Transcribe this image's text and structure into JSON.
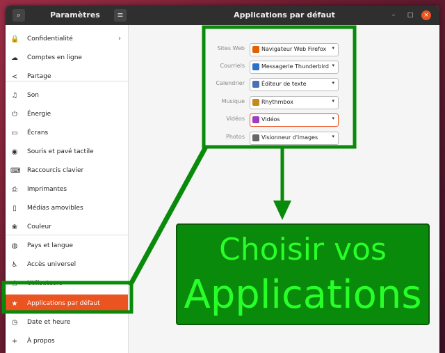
{
  "window": {
    "sidebar_title": "Paramètres",
    "title": "Applications par défaut",
    "search_icon": "search-icon",
    "menu_icon": "hamburger-menu-icon",
    "minimize": "–",
    "maximize": "□",
    "close": "×"
  },
  "sidebar": {
    "items": [
      {
        "icon": "lock-icon",
        "glyph": "🔒",
        "label": "Confidentialité",
        "chevron": "›"
      },
      {
        "icon": "cloud-icon",
        "glyph": "☁",
        "label": "Comptes en ligne"
      },
      {
        "icon": "share-icon",
        "glyph": "<",
        "label": "Partage"
      },
      {
        "icon": "music-icon",
        "glyph": "♫",
        "label": "Son"
      },
      {
        "icon": "power-icon",
        "glyph": "⏻",
        "label": "Énergie"
      },
      {
        "icon": "display-icon",
        "glyph": "▭",
        "label": "Écrans"
      },
      {
        "icon": "mouse-icon",
        "glyph": "◉",
        "label": "Souris et pavé tactile"
      },
      {
        "icon": "keyboard-icon",
        "glyph": "⌨",
        "label": "Raccourcis clavier"
      },
      {
        "icon": "printer-icon",
        "glyph": "⎙",
        "label": "Imprimantes"
      },
      {
        "icon": "removable-media-icon",
        "glyph": "▯",
        "label": "Médias amovibles"
      },
      {
        "icon": "color-icon",
        "glyph": "❀",
        "label": "Couleur"
      },
      {
        "icon": "globe-icon",
        "glyph": "◍",
        "label": "Pays et langue"
      },
      {
        "icon": "accessibility-icon",
        "glyph": "♿",
        "label": "Accès universel"
      },
      {
        "icon": "users-icon",
        "glyph": "♙",
        "label": "Utilisateurs"
      },
      {
        "icon": "star-icon",
        "glyph": "★",
        "label": "Applications par défaut",
        "active": true
      },
      {
        "icon": "clock-icon",
        "glyph": "◷",
        "label": "Date et heure"
      },
      {
        "icon": "plus-icon",
        "glyph": "+",
        "label": "À propos"
      }
    ]
  },
  "defaults": {
    "rows": [
      {
        "label": "Sites Web",
        "value": "Navigateur Web Firefox",
        "icon": "firefox-icon",
        "color": "#e66000"
      },
      {
        "label": "Courriels",
        "value": "Messagerie Thunderbird",
        "icon": "thunderbird-icon",
        "color": "#2a6fc9"
      },
      {
        "label": "Calendrier",
        "value": "Éditeur de texte",
        "icon": "text-editor-icon",
        "color": "#4a6fb5"
      },
      {
        "label": "Musique",
        "value": "Rhythmbox",
        "icon": "rhythmbox-icon",
        "color": "#c58a1a"
      },
      {
        "label": "Vidéos",
        "value": "Vidéos",
        "icon": "videos-icon",
        "color": "#9b3fc0",
        "focused": true
      },
      {
        "label": "Photos",
        "value": "Visionneur d'images",
        "icon": "image-viewer-icon",
        "color": "#666666"
      }
    ]
  },
  "callout": {
    "line1": "Choisir vos",
    "line2": "Applications",
    "color": "#0a8a0a",
    "text_color": "#28ff28"
  },
  "colors": {
    "accent": "#e95420",
    "annotation": "#0a8a0a"
  }
}
